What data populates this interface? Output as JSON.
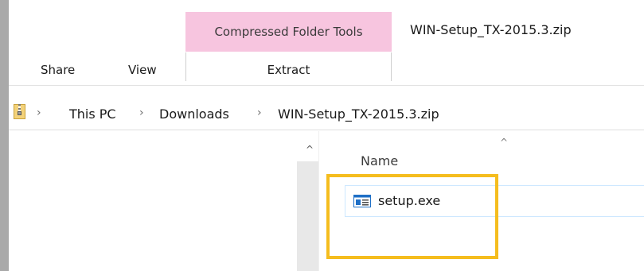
{
  "ribbon": {
    "context_group_label": "Compressed Folder Tools",
    "window_title": "WIN-Setup_TX-2015.3.zip",
    "tabs": {
      "share": "Share",
      "view": "View",
      "extract": "Extract"
    },
    "context_color": "#f7c5df"
  },
  "address_bar": {
    "separator": "›",
    "crumbs": [
      "This PC",
      "Downloads",
      "WIN-Setup_TX-2015.3.zip"
    ],
    "icon": "zip-folder-icon"
  },
  "nav_pane": {
    "scroll_up_glyph": "^"
  },
  "file_list": {
    "sort_glyph": "^",
    "column_header": "Name",
    "files": [
      {
        "name": "setup.exe",
        "icon": "exe-file-icon"
      }
    ]
  },
  "annotation": {
    "highlight_color": "#f5bd1e"
  }
}
